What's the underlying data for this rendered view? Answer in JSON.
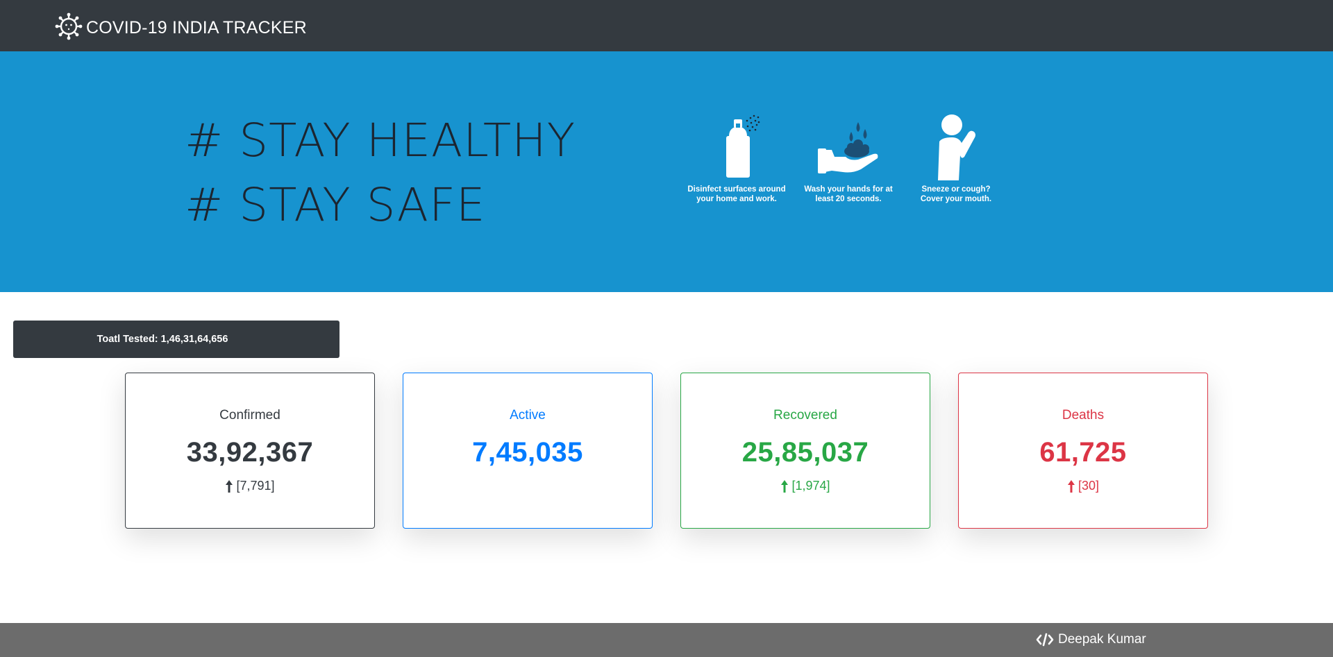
{
  "navbar": {
    "brand_icon": "virus-icon",
    "brand_text": "COVID-19 INDIA TRACKER",
    "background": "#343a40"
  },
  "hero": {
    "background": "#1793cf",
    "slogans": [
      "# STAY HEALTHY",
      "# STAY SAFE"
    ],
    "tips": [
      {
        "icon": "spray-bottle-icon",
        "caption": "Disinfect surfaces around\nyour home and work."
      },
      {
        "icon": "hand-wash-icon",
        "caption": "Wash your hands for at\nleast 20 seconds."
      },
      {
        "icon": "sneeze-person-icon",
        "caption": "Sneeze or cough?\nCover your mouth."
      }
    ]
  },
  "tested": {
    "label": "Toatl Tested: 1,46,31,64,656"
  },
  "cards": [
    {
      "title": "Confirmed",
      "value": "33,92,367",
      "delta": "[7,791]",
      "color": "#343a40"
    },
    {
      "title": "Active",
      "value": "7,45,035",
      "delta": "",
      "color": "#007bff"
    },
    {
      "title": "Recovered",
      "value": "25,85,037",
      "delta": "[1,974]",
      "color": "#28a745"
    },
    {
      "title": "Deaths",
      "value": "61,725",
      "delta": "[30]",
      "color": "#dc3545"
    }
  ],
  "footer": {
    "icon": "code-icon",
    "author": "Deepak Kumar",
    "background": "#6c6c6c"
  }
}
